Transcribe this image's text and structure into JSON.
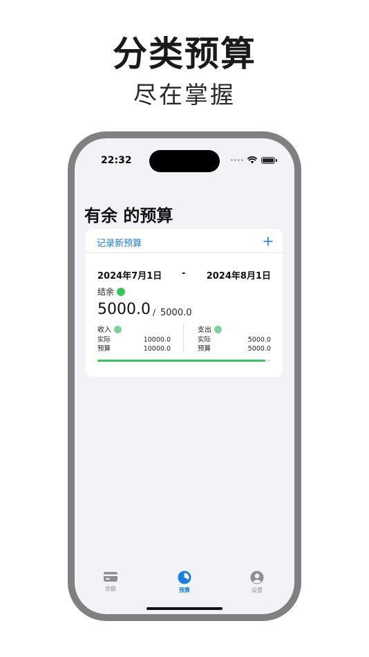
{
  "hero": {
    "title": "分类预算",
    "subtitle": "尽在掌握"
  },
  "status_bar": {
    "time": "22:32"
  },
  "page": {
    "title": "有余 的预算"
  },
  "card": {
    "new_budget_label": "记录新预算",
    "add_icon": "plus-icon",
    "date_start": "2024年7月1日",
    "date_separator": "-",
    "date_end": "2024年8月1日",
    "balance_label": "结余",
    "balance_amount": "5000.0",
    "amount_slash": "/",
    "budget_amount": "5000.0",
    "income": {
      "label": "收入",
      "actual_label": "实际",
      "actual_value": "10000.0",
      "budget_label": "预算",
      "budget_value": "10000.0"
    },
    "expense": {
      "label": "支出",
      "actual_label": "实际",
      "actual_value": "5000.0",
      "budget_label": "预算",
      "budget_value": "5000.0"
    },
    "progress_fraction": 0.97
  },
  "tabs": [
    {
      "label": "余额",
      "icon": "card-icon",
      "active": false
    },
    {
      "label": "预算",
      "icon": "pie-chart-icon",
      "active": true
    },
    {
      "label": "设置",
      "icon": "person-icon",
      "active": false
    }
  ],
  "colors": {
    "accent": "#1b7fe0",
    "positive": "#34c759",
    "frame": "#808080",
    "screen_bg": "#f2f2f7"
  }
}
